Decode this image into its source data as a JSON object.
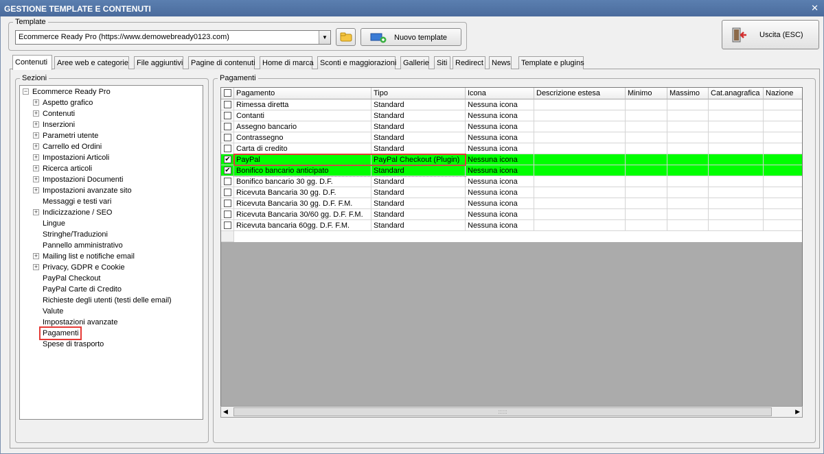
{
  "window": {
    "title": "GESTIONE TEMPLATE E CONTENUTI",
    "close_glyph": "✕"
  },
  "template_group": {
    "legend": "Template",
    "selected": "Ecommerce Ready Pro (https://www.demowebready0123.com)",
    "new_label": "Nuovo template"
  },
  "exit_label": "Uscita (ESC)",
  "tabs": [
    "Contenuti",
    "Aree web e categorie",
    "File aggiuntivi",
    "Pagine di contenuti",
    "Home di marca",
    "Sconti e maggiorazioni",
    "Gallerie",
    "Siti",
    "Redirect",
    "News",
    "Template e plugins"
  ],
  "sections": {
    "legend": "Sezioni",
    "root": "Ecommerce Ready Pro",
    "items": [
      {
        "label": "Aspetto grafico",
        "expandable": true
      },
      {
        "label": "Contenuti",
        "expandable": true
      },
      {
        "label": "Inserzioni",
        "expandable": true
      },
      {
        "label": "Parametri utente",
        "expandable": true
      },
      {
        "label": "Carrello ed Ordini",
        "expandable": true
      },
      {
        "label": "Impostazioni Articoli",
        "expandable": true
      },
      {
        "label": "Ricerca articoli",
        "expandable": true
      },
      {
        "label": "Impostazioni Documenti",
        "expandable": true
      },
      {
        "label": "Impostazioni avanzate sito",
        "expandable": true
      },
      {
        "label": "Messaggi e testi vari",
        "expandable": false
      },
      {
        "label": "Indicizzazione / SEO",
        "expandable": true
      },
      {
        "label": "Lingue",
        "expandable": false
      },
      {
        "label": "Stringhe/Traduzioni",
        "expandable": false
      },
      {
        "label": "Pannello amministrativo",
        "expandable": false
      },
      {
        "label": "Mailing list e notifiche email",
        "expandable": true
      },
      {
        "label": "Privacy, GDPR e Cookie",
        "expandable": true
      },
      {
        "label": "PayPal Checkout",
        "expandable": false
      },
      {
        "label": "PayPal Carte di Credito",
        "expandable": false
      },
      {
        "label": "Richieste degli utenti (testi delle email)",
        "expandable": false
      },
      {
        "label": "Valute",
        "expandable": false
      },
      {
        "label": "Impostazioni avanzate",
        "expandable": false
      },
      {
        "label": "Pagamenti",
        "expandable": false,
        "selected": true
      },
      {
        "label": "Spese di trasporto",
        "expandable": false
      }
    ]
  },
  "payments": {
    "legend": "Pagamenti",
    "columns": [
      "Pagamento",
      "Tipo",
      "Icona",
      "Descrizione estesa",
      "Minimo",
      "Massimo",
      "Cat.anagrafica",
      "Nazione"
    ],
    "rows": [
      {
        "checked": false,
        "name": "Rimessa diretta",
        "type": "Standard",
        "icon": "Nessuna icona",
        "highlight": false
      },
      {
        "checked": false,
        "name": "Contanti",
        "type": "Standard",
        "icon": "Nessuna icona",
        "highlight": false
      },
      {
        "checked": false,
        "name": "Assegno bancario",
        "type": "Standard",
        "icon": "Nessuna icona",
        "highlight": false
      },
      {
        "checked": false,
        "name": "Contrassegno",
        "type": "Standard",
        "icon": "Nessuna icona",
        "highlight": false
      },
      {
        "checked": false,
        "name": "Carta di credito",
        "type": "Standard",
        "icon": "Nessuna icona",
        "highlight": false
      },
      {
        "checked": true,
        "name": "PayPal",
        "type": "PayPal Checkout (Plugin)",
        "icon": "Nessuna icona",
        "highlight": true
      },
      {
        "checked": true,
        "name": "Bonifico bancario anticipato",
        "type": "Standard",
        "icon": "Nessuna icona",
        "highlight": true
      },
      {
        "checked": false,
        "name": "Bonifico bancario 30 gg. D.F.",
        "type": "Standard",
        "icon": "Nessuna icona",
        "highlight": false
      },
      {
        "checked": false,
        "name": "Ricevuta Bancaria 30 gg. D.F.",
        "type": "Standard",
        "icon": "Nessuna icona",
        "highlight": false
      },
      {
        "checked": false,
        "name": "Ricevuta Bancaria 30 gg. D.F. F.M.",
        "type": "Standard",
        "icon": "Nessuna icona",
        "highlight": false
      },
      {
        "checked": false,
        "name": "Ricevuta Bancaria 30/60 gg. D.F. F.M.",
        "type": "Standard",
        "icon": "Nessuna icona",
        "highlight": false
      },
      {
        "checked": false,
        "name": "Ricevuta bancaria 60gg. D.F. F.M.",
        "type": "Standard",
        "icon": "Nessuna icona",
        "highlight": false
      }
    ]
  },
  "icons": {
    "combo_arrow": "▼",
    "scroll_left": "◀",
    "scroll_right": "▶",
    "check": "✔",
    "expand": "+",
    "collapse": "−",
    "thumb_grip": "::::::"
  },
  "colors": {
    "highlight": "#00ff00",
    "annotation": "#e53935",
    "titlebar": "#4a6b9c"
  }
}
